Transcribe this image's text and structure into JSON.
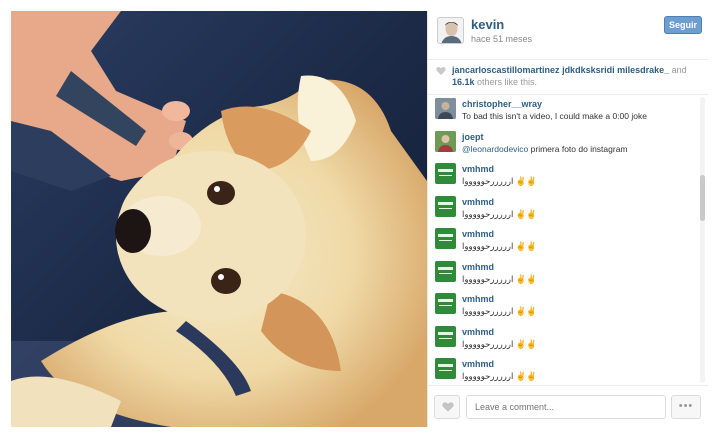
{
  "post": {
    "username": "kevin",
    "time_ago": "hace 51 meses",
    "follow_label": "Seguir"
  },
  "likes": {
    "likers": [
      "jancarloscastillomartinez",
      "jdkdksksridi",
      "milesdrake_"
    ],
    "and_text": "and",
    "count": "16.1k",
    "others_text": " others like this."
  },
  "comments": [
    {
      "user": "christopher__wray",
      "text": "To bad this isn't a video, I could make a 0:00 joke",
      "avatar": "photo-avatar"
    },
    {
      "user": "joept",
      "mention": "@leonardodevico",
      "text": " primera foto do instagram",
      "avatar": "photo-avatar"
    },
    {
      "user": "vmhmd",
      "text": "ارررررحوووووا ✌✌",
      "avatar": "saudi-flag-avatar"
    },
    {
      "user": "vmhmd",
      "text": "ارررررحوووووا ✌✌",
      "avatar": "saudi-flag-avatar"
    },
    {
      "user": "vmhmd",
      "text": "ارررررحوووووا ✌✌",
      "avatar": "saudi-flag-avatar"
    },
    {
      "user": "vmhmd",
      "text": "ارررررحوووووا ✌✌",
      "avatar": "saudi-flag-avatar"
    },
    {
      "user": "vmhmd",
      "text": "ارررررحوووووا ✌✌",
      "avatar": "saudi-flag-avatar"
    },
    {
      "user": "vmhmd",
      "text": "ارررررحوووووا ✌✌",
      "avatar": "saudi-flag-avatar"
    },
    {
      "user": "vmhmd",
      "text": "ارررررحوووووا ✌✌",
      "avatar": "saudi-flag-avatar"
    }
  ],
  "composer": {
    "placeholder": "Leave a comment...",
    "more_label": "•••"
  },
  "icons": {
    "like": "heart-icon",
    "more": "ellipsis-icon"
  },
  "colors": {
    "link": "#2e5e86",
    "follow_button": "#6d9ed0"
  }
}
